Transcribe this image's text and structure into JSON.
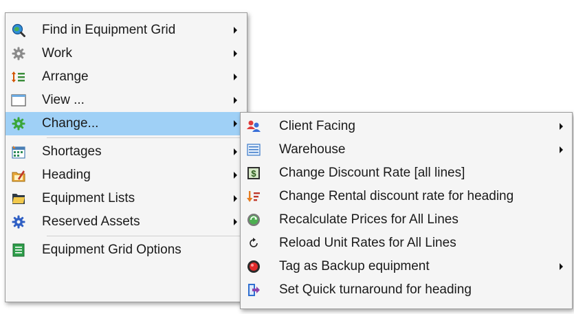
{
  "main_menu": {
    "items": [
      {
        "label": "Find in Equipment Grid",
        "icon": "search-globe-icon",
        "submenu": true
      },
      {
        "label": "Work",
        "icon": "gear-icon",
        "submenu": true
      },
      {
        "label": "Arrange",
        "icon": "sort-list-icon",
        "submenu": true
      },
      {
        "label": "View ...",
        "icon": "window-icon",
        "submenu": true
      },
      {
        "label": "Change...",
        "icon": "green-gear-icon",
        "submenu": true,
        "highlighted": true
      },
      {
        "label": "Shortages",
        "icon": "calendar-icon",
        "submenu": true
      },
      {
        "label": "Heading",
        "icon": "heading-edit-icon",
        "submenu": true
      },
      {
        "label": "Equipment Lists",
        "icon": "folder-icon",
        "submenu": true
      },
      {
        "label": "Reserved Assets",
        "icon": "blue-gear-icon",
        "submenu": true
      },
      {
        "label": "Equipment Grid Options",
        "icon": "options-list-icon",
        "submenu": false
      }
    ]
  },
  "change_submenu": {
    "items": [
      {
        "label": "Client Facing",
        "icon": "users-icon",
        "submenu": true
      },
      {
        "label": "Warehouse",
        "icon": "warehouse-list-icon",
        "submenu": true
      },
      {
        "label": "Change Discount Rate [all lines]",
        "icon": "dollar-icon",
        "submenu": false
      },
      {
        "label": "Change Rental discount rate for heading",
        "icon": "sort-down-icon",
        "submenu": false
      },
      {
        "label": "Recalculate Prices for All Lines",
        "icon": "recalculate-icon",
        "submenu": false
      },
      {
        "label": "Reload Unit Rates for All Lines",
        "icon": "reload-icon",
        "submenu": false
      },
      {
        "label": "Tag as Backup equipment",
        "icon": "record-icon",
        "submenu": true
      },
      {
        "label": "Set Quick turnaround for heading",
        "icon": "exit-arrow-icon",
        "submenu": false
      }
    ]
  },
  "colors": {
    "menu_background": "#f5f5f5",
    "highlight": "#9fd0f6",
    "border": "#9a9a9a"
  }
}
